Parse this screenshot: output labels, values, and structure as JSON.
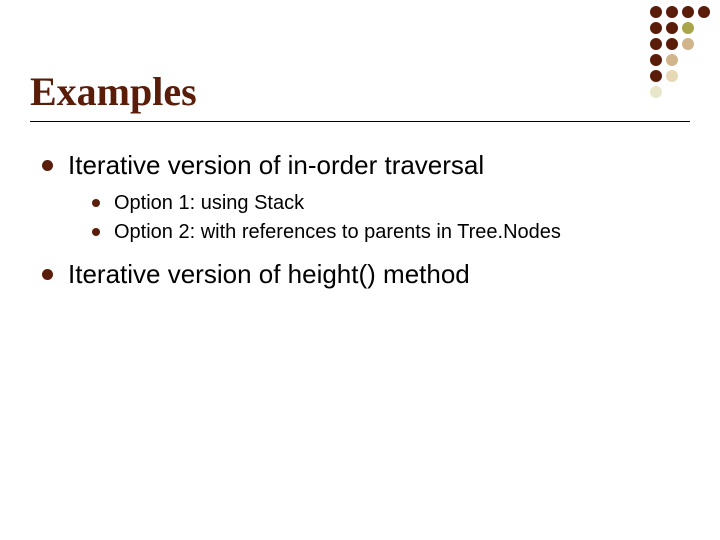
{
  "title": "Examples",
  "bullets": [
    {
      "text": "Iterative version of in-order traversal",
      "children": [
        "Option 1: using Stack",
        "Option 2: with references to parents in Tree.Nodes"
      ]
    },
    {
      "text": "Iterative version of height() method",
      "children": []
    }
  ],
  "decor": {
    "dot_classes": [
      "d-dark",
      "d-dark",
      "d-dark",
      "d-dark",
      "d-dark",
      "d-dark",
      "d-olive",
      "d-none",
      "d-dark",
      "d-dark",
      "d-tan",
      "d-none",
      "d-dark",
      "d-tan",
      "d-none",
      "d-none",
      "d-dark",
      "d-lt",
      "d-none",
      "d-none",
      "d-ltg",
      "d-none",
      "d-none",
      "d-none"
    ]
  }
}
